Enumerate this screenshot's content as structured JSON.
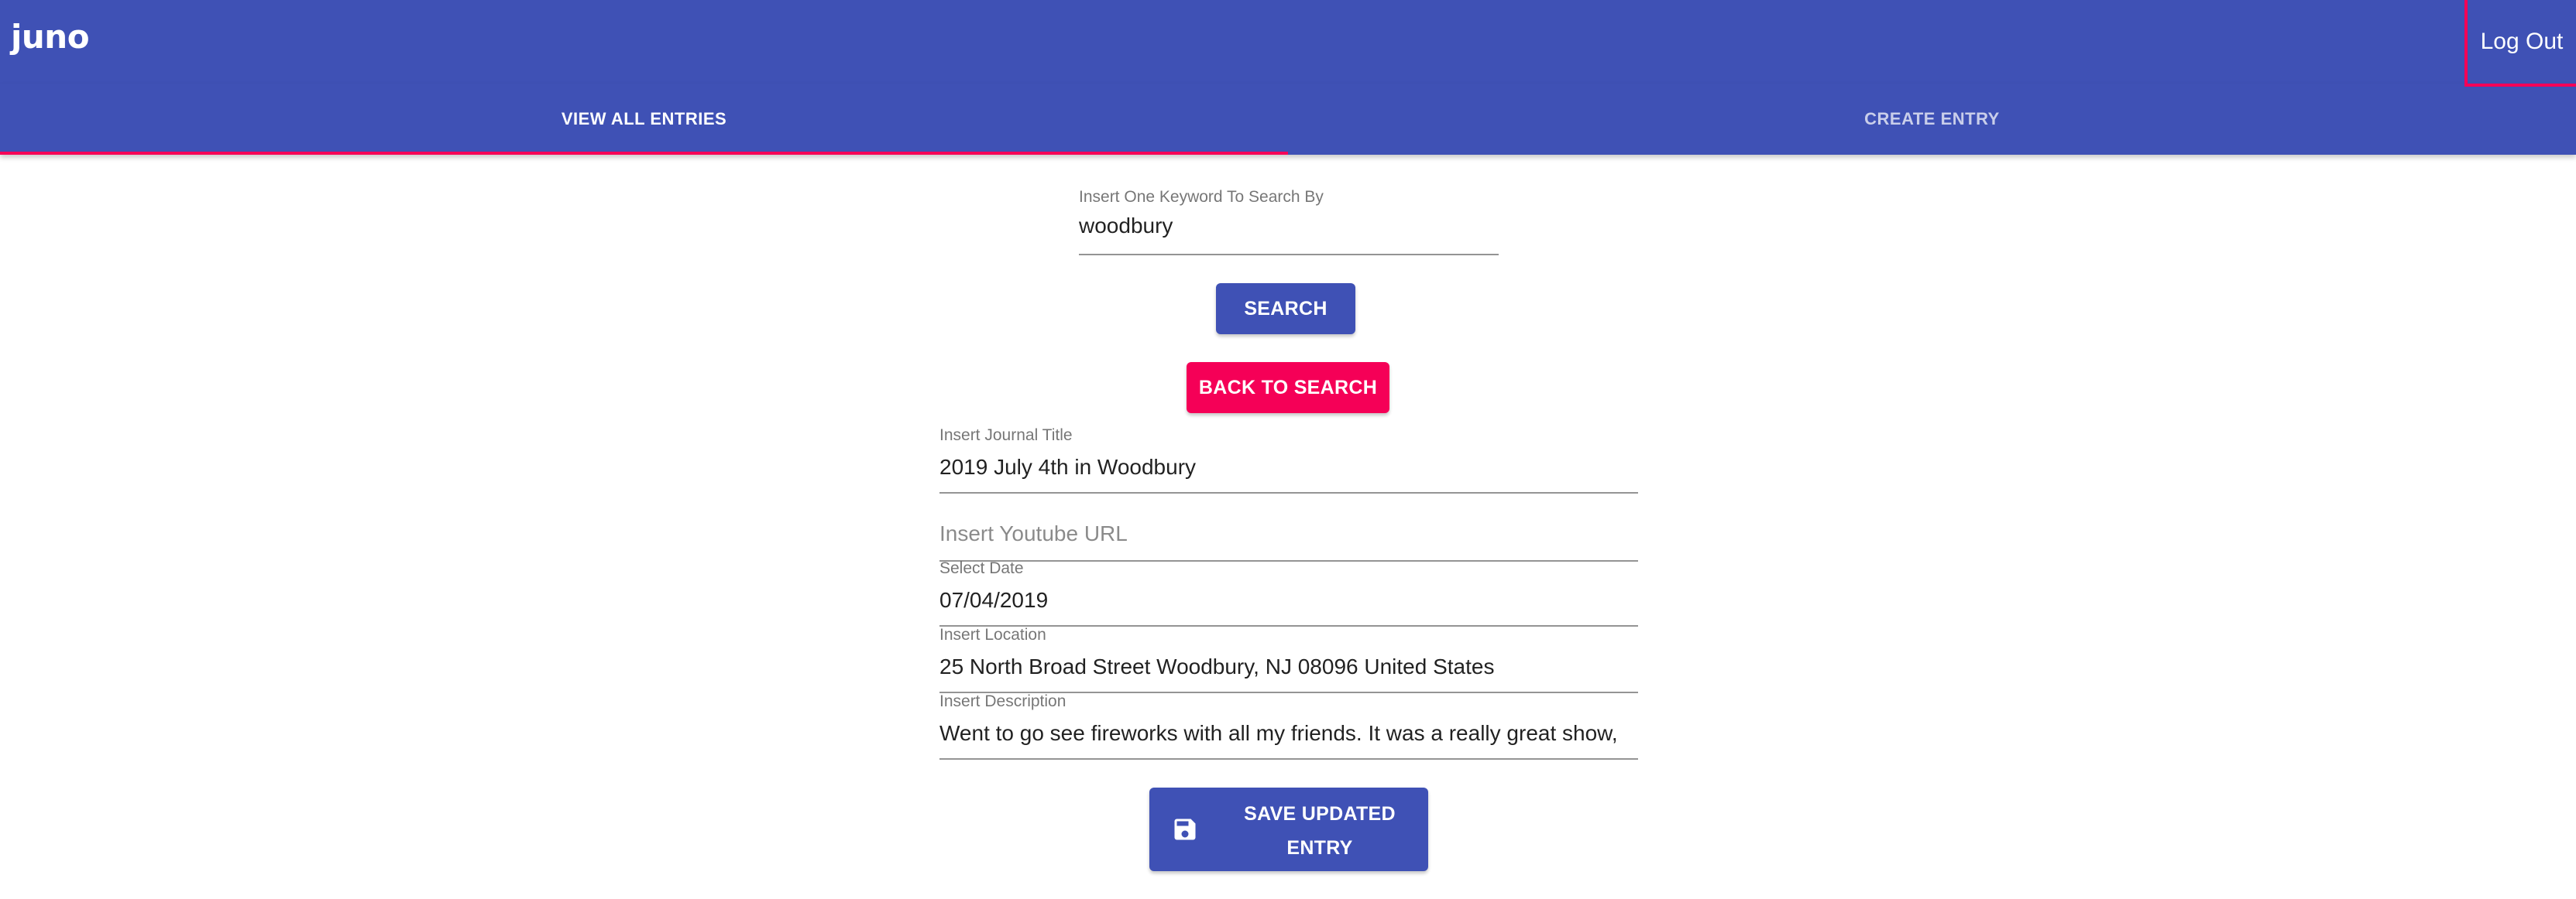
{
  "app": {
    "logo": "juno",
    "logout_label": "Log Out",
    "tabs": [
      {
        "label": "VIEW ALL ENTRIES",
        "active": true
      },
      {
        "label": "CREATE ENTRY",
        "active": false
      }
    ]
  },
  "search": {
    "label": "Insert One Keyword To Search By",
    "value": "woodbury",
    "button_label": "SEARCH",
    "back_label": "BACK TO SEARCH"
  },
  "form": {
    "title": {
      "label": "Insert Journal Title",
      "value": "2019 July 4th in Woodbury"
    },
    "youtube": {
      "placeholder": "Insert Youtube URL"
    },
    "date": {
      "label": "Select Date",
      "value": "07/04/2019"
    },
    "location": {
      "label": "Insert Location",
      "value": "25 North Broad Street Woodbury, NJ 08096 United States"
    },
    "description": {
      "label": "Insert Description",
      "value": "Went to go see fireworks with all my friends. It was a really great show,"
    },
    "save_label_line1": "SAVE UPDATED",
    "save_label_line2": "ENTRY"
  },
  "colors": {
    "primary": "#3f51b5",
    "secondary": "#f50057"
  },
  "icons": {
    "save": "floppy-disk-icon"
  }
}
